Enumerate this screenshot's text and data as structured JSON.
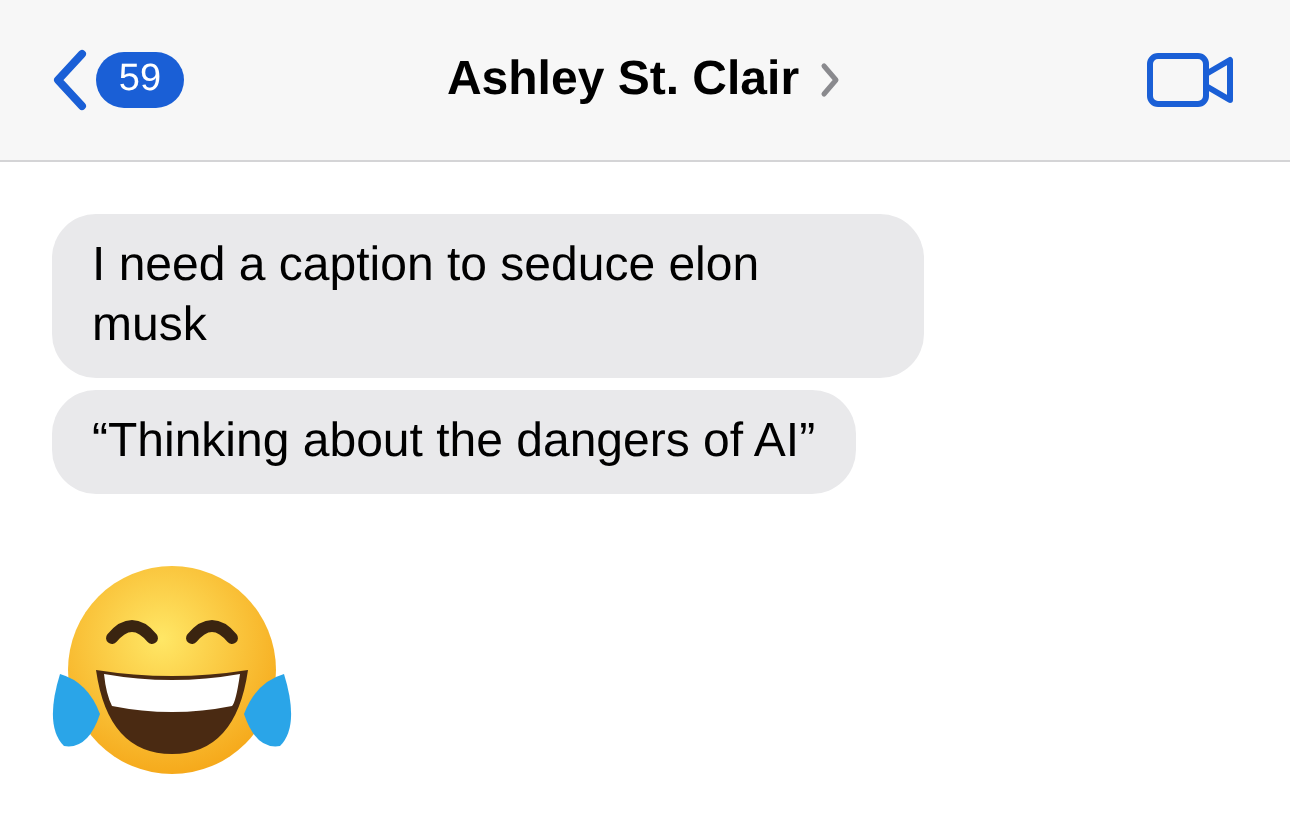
{
  "header": {
    "back_badge": "59",
    "title": "Ashley St. Clair"
  },
  "messages": [
    {
      "kind": "text",
      "text": "I need a caption to seduce elon musk"
    },
    {
      "kind": "text",
      "text": "“Thinking about the dangers of AI”"
    },
    {
      "kind": "emoji"
    }
  ]
}
